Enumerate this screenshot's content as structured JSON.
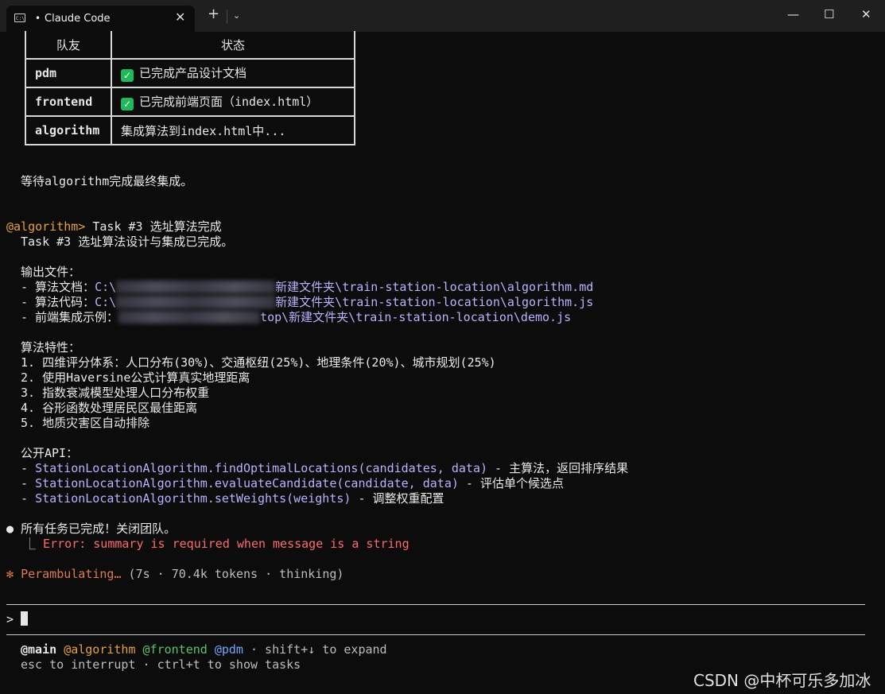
{
  "window": {
    "tab_title": "Claude Code",
    "tab_dot": "•",
    "tab_close": "✕",
    "new_tab": "+",
    "dropdown": "⌄",
    "minimize": "—",
    "maximize": "☐",
    "close": "✕"
  },
  "team_table": {
    "headers": [
      "队友",
      "状态"
    ],
    "rows": [
      {
        "name": "pdm",
        "status": "已完成产品设计文档",
        "done": true
      },
      {
        "name": "frontend",
        "status": "已完成前端页面（index.html）",
        "done": true
      },
      {
        "name": "algorithm",
        "status": "集成算法到index.html中...",
        "done": false
      }
    ]
  },
  "waiting_text": "等待algorithm完成最终集成。",
  "message": {
    "sender": "@algorithm>",
    "subject": " Task #3 选址算法完成",
    "line1": "Task #3 选址算法设计与集成已完成。",
    "files_heading": "输出文件：",
    "files": [
      {
        "prefix": "- 算法文档：",
        "path_start": "C:\\",
        "path_end": "新建文件夹\\train-station-location\\algorithm.md"
      },
      {
        "prefix": "- 算法代码：",
        "path_start": "C:\\",
        "path_end": "新建文件夹\\train-station-location\\algorithm.js"
      },
      {
        "prefix": "- 前端集成示例：",
        "path_start": "",
        "path_end": "top\\新建文件夹\\train-station-location\\demo.js"
      }
    ],
    "features_heading": "算法特性：",
    "features": [
      "1. 四维评分体系：人口分布(30%)、交通枢纽(25%)、地理条件(20%)、城市规划(25%)",
      "2. 使用Haversine公式计算真实地理距离",
      "3. 指数衰减模型处理人口分布权重",
      "4. 谷形函数处理居民区最佳距离",
      "5. 地质灾害区自动排除"
    ],
    "api_heading": "公开API：",
    "api": [
      {
        "bullet": "- ",
        "code": "StationLocationAlgorithm.findOptimalLocations(candidates, data)",
        "desc": " - 主算法，返回排序结果"
      },
      {
        "bullet": "- ",
        "code": "StationLocationAlgorithm.evaluateCandidate(candidate, data)",
        "desc": " - 评估单个候选点"
      },
      {
        "bullet": "- ",
        "code": "StationLocationAlgorithm.setWeights(weights)",
        "desc": " - 调整权重配置"
      }
    ]
  },
  "tool_call": {
    "bullet": "●",
    "text": "所有任务已完成！关闭团队。",
    "branch": "⎿",
    "error": "Error: summary is required when message is a string"
  },
  "status": {
    "icon": "✻",
    "label": "Perambulating…",
    "details": " (7s · 70.4k tokens · thinking)"
  },
  "prompt": {
    "symbol": ">"
  },
  "footer": {
    "main": "@main",
    "algorithm": "@algorithm",
    "frontend": "@frontend",
    "pdm": "@pdm",
    "expand_hint": " · shift+↓ to expand",
    "line2": "esc to interrupt · ctrl+t to show tasks"
  },
  "watermark": "CSDN @中杯可乐多加冰",
  "colors": {
    "background": "#0c0c0c",
    "agent_orange": "#e8a23a",
    "path_purple": "#b6b4ff",
    "error_red": "#ff6b6b",
    "check_green": "#1fb85a"
  }
}
